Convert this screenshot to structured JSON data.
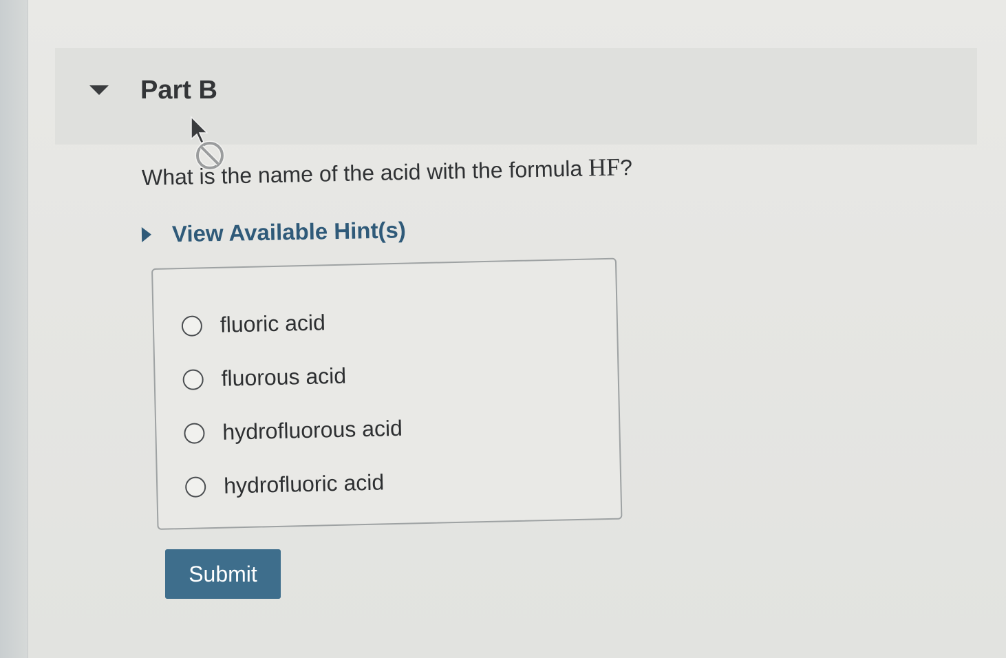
{
  "part": {
    "title": "Part B"
  },
  "question": {
    "prefix": "What is the name of the acid with the formula ",
    "formula": "HF",
    "suffix": "?"
  },
  "hints": {
    "label": "View Available Hint(s)"
  },
  "options": [
    {
      "label": "fluoric acid",
      "selected": false
    },
    {
      "label": "fluorous acid",
      "selected": false
    },
    {
      "label": "hydrofluorous acid",
      "selected": false
    },
    {
      "label": "hydrofluoric acid",
      "selected": false
    }
  ],
  "submit": {
    "label": "Submit"
  },
  "colors": {
    "accent": "#2f5a79",
    "button": "#3e6e8c",
    "background": "#e6e6e3"
  },
  "icons": {
    "collapse": "triangle-down-icon",
    "hint_toggle": "triangle-right-icon",
    "cursor": "not-allowed-cursor-icon"
  }
}
